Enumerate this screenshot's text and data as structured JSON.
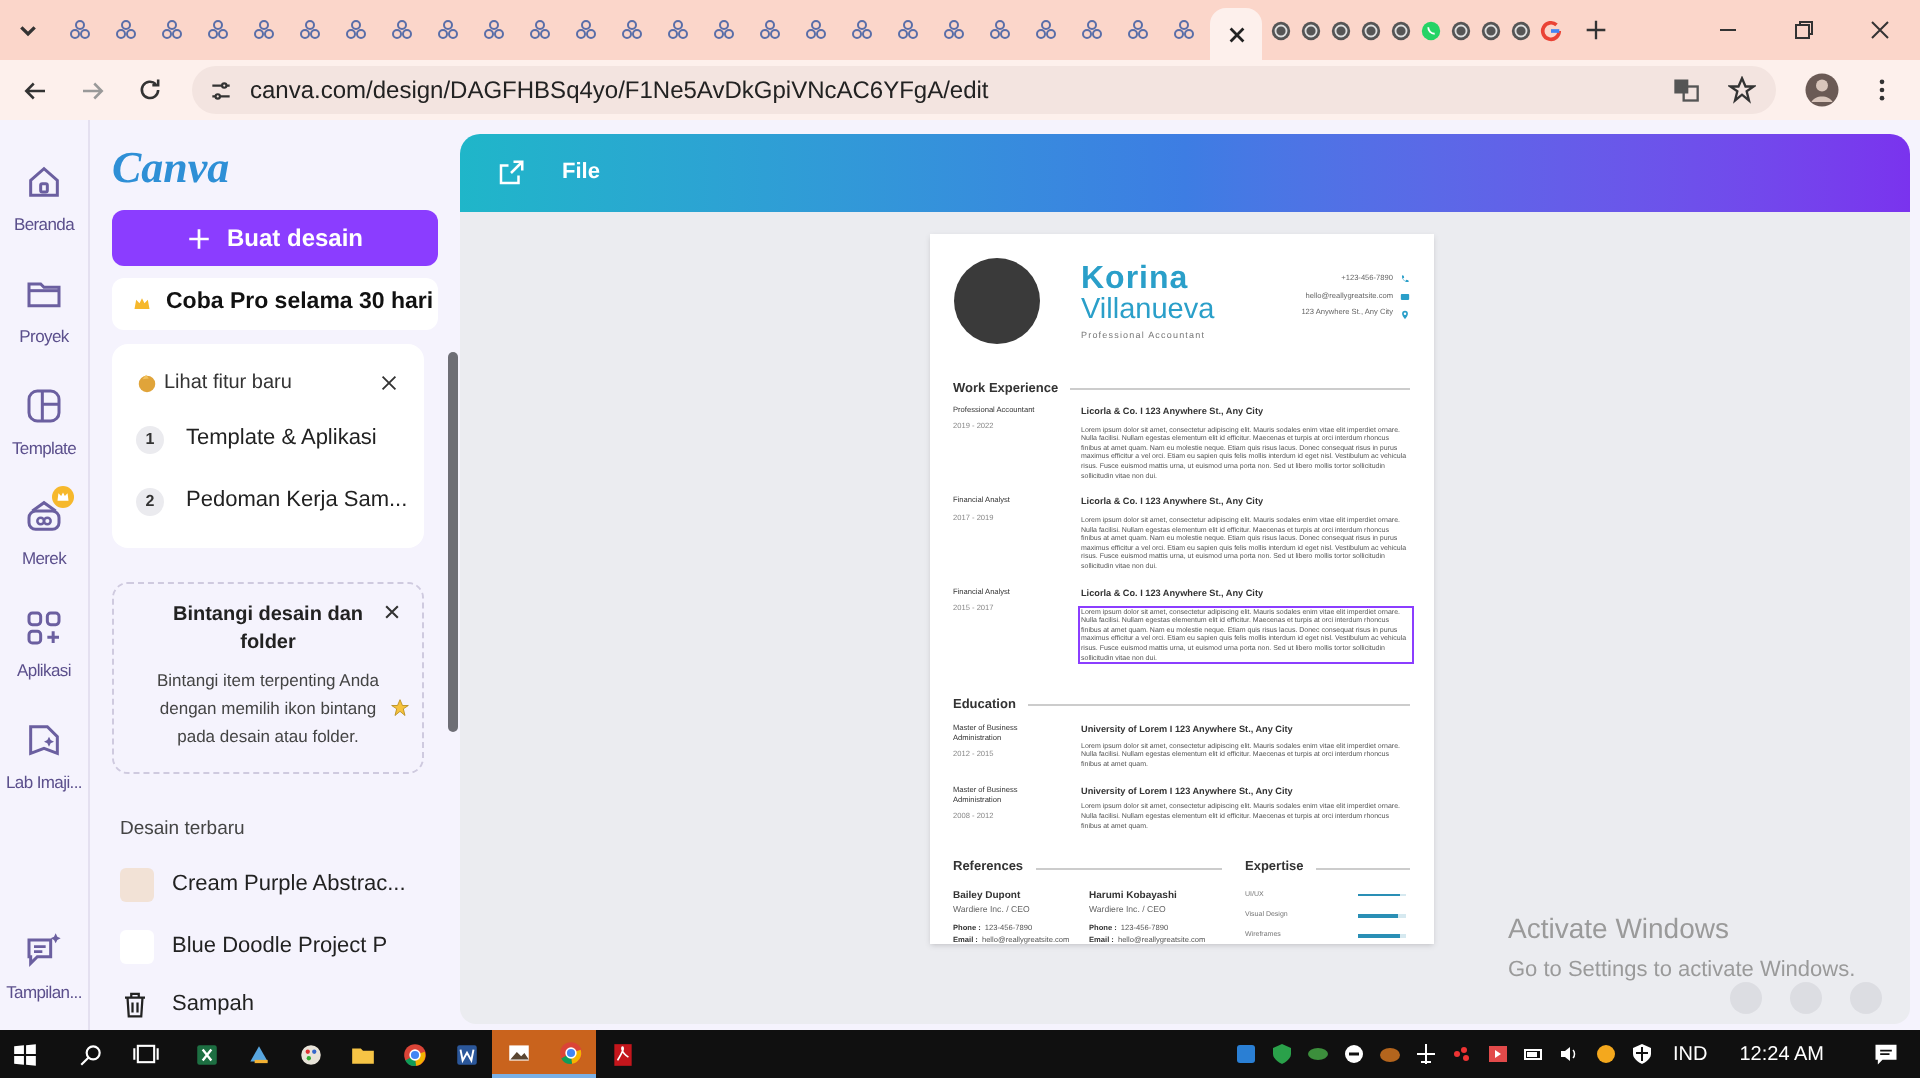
{
  "browser": {
    "tabs": [
      {
        "kind": "canva",
        "selected": false
      },
      {
        "kind": "canva",
        "selected": false
      },
      {
        "kind": "canva",
        "selected": false
      },
      {
        "kind": "canva",
        "selected": false
      },
      {
        "kind": "canva",
        "selected": false
      },
      {
        "kind": "canva",
        "selected": false
      },
      {
        "kind": "canva",
        "selected": false
      },
      {
        "kind": "canva",
        "selected": false
      },
      {
        "kind": "canva",
        "selected": false
      },
      {
        "kind": "canva",
        "selected": false
      },
      {
        "kind": "canva",
        "selected": false
      },
      {
        "kind": "canva",
        "selected": false
      },
      {
        "kind": "canva",
        "selected": false
      },
      {
        "kind": "canva",
        "selected": false
      },
      {
        "kind": "canva",
        "selected": false
      },
      {
        "kind": "canva",
        "selected": false
      },
      {
        "kind": "canva",
        "selected": false
      },
      {
        "kind": "canva",
        "selected": false
      },
      {
        "kind": "canva",
        "selected": false
      },
      {
        "kind": "canva",
        "selected": false
      },
      {
        "kind": "canva",
        "selected": false
      },
      {
        "kind": "canva",
        "selected": false
      },
      {
        "kind": "canva",
        "selected": false
      },
      {
        "kind": "canva",
        "selected": false
      },
      {
        "kind": "canva",
        "selected": false
      },
      {
        "kind": "blank",
        "selected": true
      },
      {
        "kind": "globe",
        "selected": false
      },
      {
        "kind": "globe",
        "selected": false
      },
      {
        "kind": "globe",
        "selected": false
      },
      {
        "kind": "globe",
        "selected": false
      },
      {
        "kind": "globe",
        "selected": false
      },
      {
        "kind": "whatsapp",
        "selected": false
      },
      {
        "kind": "globe",
        "selected": false
      },
      {
        "kind": "globe",
        "selected": false
      },
      {
        "kind": "globe",
        "selected": false
      },
      {
        "kind": "google",
        "selected": false
      }
    ],
    "url": "canva.com/design/DAGFHBSq4yo/F1Ne5AvDkGpiVNcAC6YFgA/edit"
  },
  "rail": [
    {
      "label": "Beranda",
      "kind": "home",
      "badge": false
    },
    {
      "label": "Proyek",
      "kind": "folder",
      "badge": false
    },
    {
      "label": "Template",
      "kind": "template",
      "badge": false
    },
    {
      "label": "Merek",
      "kind": "brand",
      "badge": true
    },
    {
      "label": "Aplikasi",
      "kind": "apps",
      "badge": false
    },
    {
      "label": "Lab Imaji...",
      "kind": "lab",
      "badge": false
    },
    {
      "label": "Tampilan...",
      "kind": "chat",
      "badge": false
    }
  ],
  "panel": {
    "logo": "Canva",
    "create_button": "Buat desain",
    "pro_button": "Coba Pro selama 30 hari",
    "whats_new": {
      "title": "Lihat fitur baru",
      "items": [
        {
          "number": "1",
          "label": "Template & Aplikasi"
        },
        {
          "number": "2",
          "label": "Pedoman Kerja Sam..."
        }
      ]
    },
    "star_tip": {
      "title": "Bintangi desain dan folder",
      "body_start": "Bintangi item terpenting Anda dengan memilih ikon bintang",
      "body_end": "pada desain atau folder."
    },
    "recent": {
      "title": "Desain terbaru",
      "items": [
        "Cream Purple Abstrac...",
        "Blue Doodle Project P"
      ]
    },
    "trash": "Sampah"
  },
  "editor": {
    "menu": "File"
  },
  "resume": {
    "first_name": "Korina",
    "last_name": "Villanueva",
    "role": "Professional Accountant",
    "contacts": [
      {
        "kind": "phone",
        "text": "+123-456-7890"
      },
      {
        "kind": "mail",
        "text": "hello@reallygreatsite.com"
      },
      {
        "kind": "pin",
        "text": "123 Anywhere St., Any City"
      }
    ],
    "work": {
      "title": "Work Experience",
      "entries": [
        {
          "position": "Professional Accountant",
          "years": "2019 - 2022",
          "company": "Licorla & Co. I 123 Anywhere St., Any City",
          "body": "Lorem ipsum dolor sit amet, consectetur adipiscing elit. Mauris sodales enim vitae elit imperdiet ornare. Nulla facilisi. Nullam egestas elementum elit id efficitur. Maecenas et turpis at orci interdum rhoncus finibus at amet quam. Nam eu molestie neque. Etiam quis risus lacus. Donec consequat risus in purus maximus efficitur a vel orci. Etiam eu sapien quis felis mollis interdum id eget nisl. Vestibulum ac vehicula risus. Fusce euismod mattis urna, ut euismod urna porta non. Sed ut libero mollis tortor sollicitudin sollicitudin vitae non dui.",
          "selected": false
        },
        {
          "position": "Financial Analyst",
          "years": "2017 - 2019",
          "company": "Licorla & Co. I 123 Anywhere St., Any City",
          "body": "Lorem ipsum dolor sit amet, consectetur adipiscing elit. Mauris sodales enim vitae elit imperdiet ornare. Nulla facilisi. Nullam egestas elementum elit id efficitur. Maecenas et turpis at orci interdum rhoncus finibus at amet quam. Nam eu molestie neque. Etiam quis risus lacus. Donec consequat risus in purus maximus efficitur a vel orci. Etiam eu sapien quis felis mollis interdum id eget nisl. Vestibulum ac vehicula risus. Fusce euismod mattis urna, ut euismod urna porta non. Sed ut libero mollis tortor sollicitudin sollicitudin vitae non dui.",
          "selected": false
        },
        {
          "position": "Financial Analyst",
          "years": "2015 - 2017",
          "company": "Licorla & Co. I 123 Anywhere St., Any City",
          "body": "Lorem ipsum dolor sit amet, consectetur adipiscing elit. Mauris sodales enim vitae elit imperdiet ornare. Nulla facilisi. Nullam egestas elementum elit id efficitur. Maecenas et turpis at orci interdum rhoncus finibus at amet quam. Nam eu molestie neque. Etiam quis risus lacus. Donec consequat risus in purus maximus efficitur a vel orci. Etiam eu sapien quis felis mollis interdum id eget nisl. Vestibulum ac vehicula risus. Fusce euismod mattis urna, ut euismod urna porta non. Sed ut libero mollis tortor sollicitudin sollicitudin vitae non dui.",
          "selected": true
        }
      ]
    },
    "education": {
      "title": "Education",
      "entries": [
        {
          "degree": "Master of Business Administration",
          "years": "2012 - 2015",
          "school": "University of Lorem I 123 Anywhere St., Any City",
          "body": "Lorem ipsum dolor sit amet, consectetur adipiscing elit. Mauris sodales enim vitae elit imperdiet ornare. Nulla facilisi. Nullam egestas elementum elit id efficitur. Maecenas et turpis at orci interdum rhoncus finibus at amet quam."
        },
        {
          "degree": "Master of Business Administration",
          "years": "2008 - 2012",
          "school": "University of Lorem I 123 Anywhere St., Any City",
          "body": "Lorem ipsum dolor sit amet, consectetur adipiscing elit. Mauris sodales enim vitae elit imperdiet ornare. Nulla facilisi. Nullam egestas elementum elit id efficitur. Maecenas et turpis at orci interdum rhoncus finibus at amet quam."
        }
      ]
    },
    "references": {
      "title": "References",
      "people": [
        {
          "name": "Bailey Dupont",
          "company": "Wardiere Inc. / CEO",
          "phone_label": "Phone :",
          "phone": "123-456-7890",
          "email_label": "Email :",
          "email": "hello@reallygreatsite.com"
        },
        {
          "name": "Harumi Kobayashi",
          "company": "Wardiere Inc. / CEO",
          "phone_label": "Phone :",
          "phone": "123-456-7890",
          "email_label": "Email :",
          "email": "hello@reallygreatsite.com"
        }
      ]
    },
    "expertise": {
      "title": "Expertise",
      "skills": [
        {
          "label": "UI/UX",
          "level": 0.9
        },
        {
          "label": "Visual Design",
          "level": 0.85
        },
        {
          "label": "Wireframes",
          "level": 0.9
        }
      ]
    }
  },
  "watermark": {
    "title": "Activate Windows",
    "body": "Go to Settings to activate Windows."
  },
  "taskbar": {
    "apps": [
      {
        "kind": "excel",
        "active": false
      },
      {
        "kind": "app",
        "active": false
      },
      {
        "kind": "paint",
        "active": false
      },
      {
        "kind": "folder",
        "active": false
      },
      {
        "kind": "chrome",
        "active": false
      },
      {
        "kind": "word",
        "active": false
      },
      {
        "kind": "photos",
        "active": true
      },
      {
        "kind": "chrome",
        "active": true
      },
      {
        "kind": "pdf",
        "active": false
      }
    ],
    "language": "IND",
    "time": "12:24 AM"
  }
}
